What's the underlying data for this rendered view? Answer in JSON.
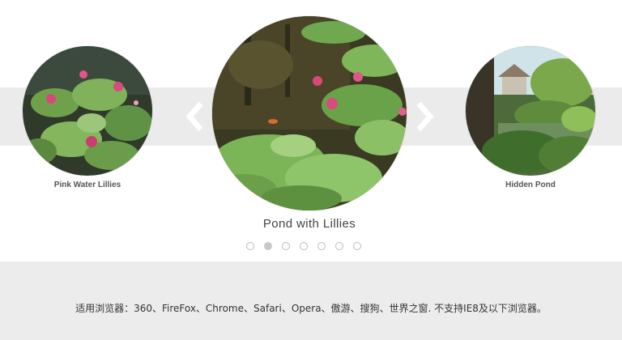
{
  "carousel": {
    "slides": [
      {
        "caption": "Pink Water Lillies",
        "image": "pink-water-lilies-photo",
        "position": "left"
      },
      {
        "caption": "Pond with Lillies",
        "image": "pond-with-lilies-photo",
        "position": "center"
      },
      {
        "caption": "Hidden Pond",
        "image": "hidden-pond-photo",
        "position": "right"
      }
    ],
    "prev_icon": "chevron-left-icon",
    "next_icon": "chevron-right-icon",
    "arrow_color": "#ffffff",
    "band_color": "#ebebeb",
    "pagination": {
      "count": 7,
      "active_index": 1
    }
  },
  "footer": {
    "text": "适用浏览器：360、FireFox、Chrome、Safari、Opera、傲游、搜狗、世界之窗. 不支持IE8及以下浏览器。"
  }
}
